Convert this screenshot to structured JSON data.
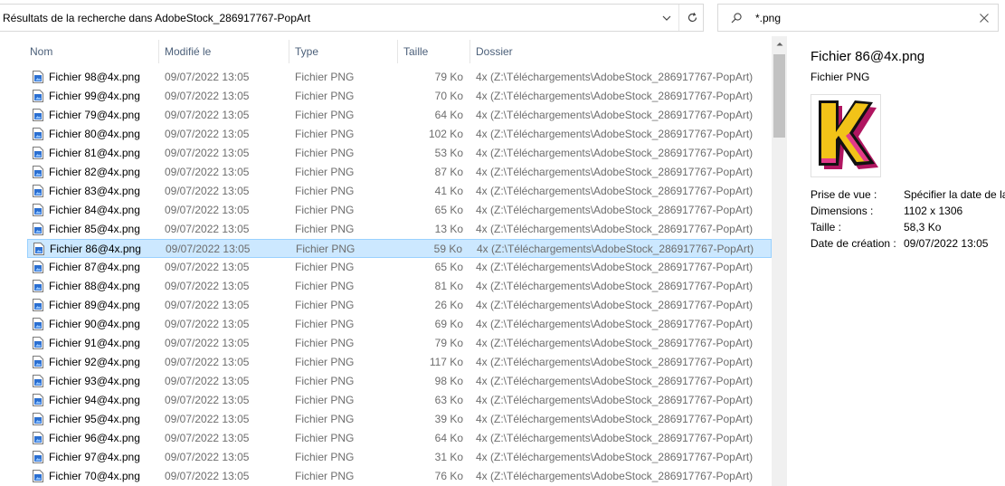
{
  "address": {
    "path": "Résultats de la recherche dans AdobeStock_286917767-PopArt"
  },
  "search": {
    "value": "*.png"
  },
  "columns": {
    "name": "Nom",
    "modified": "Modifié le",
    "type": "Type",
    "size": "Taille",
    "folder": "Dossier"
  },
  "files": [
    {
      "name": "Fichier 98@4x.png",
      "modified": "09/07/2022 13:05",
      "type": "Fichier PNG",
      "size": "79 Ko",
      "folder": "4x (Z:\\Téléchargements\\AdobeStock_286917767-PopArt)"
    },
    {
      "name": "Fichier 99@4x.png",
      "modified": "09/07/2022 13:05",
      "type": "Fichier PNG",
      "size": "70 Ko",
      "folder": "4x (Z:\\Téléchargements\\AdobeStock_286917767-PopArt)"
    },
    {
      "name": "Fichier 79@4x.png",
      "modified": "09/07/2022 13:05",
      "type": "Fichier PNG",
      "size": "64 Ko",
      "folder": "4x (Z:\\Téléchargements\\AdobeStock_286917767-PopArt)"
    },
    {
      "name": "Fichier 80@4x.png",
      "modified": "09/07/2022 13:05",
      "type": "Fichier PNG",
      "size": "102 Ko",
      "folder": "4x (Z:\\Téléchargements\\AdobeStock_286917767-PopArt)"
    },
    {
      "name": "Fichier 81@4x.png",
      "modified": "09/07/2022 13:05",
      "type": "Fichier PNG",
      "size": "53 Ko",
      "folder": "4x (Z:\\Téléchargements\\AdobeStock_286917767-PopArt)"
    },
    {
      "name": "Fichier 82@4x.png",
      "modified": "09/07/2022 13:05",
      "type": "Fichier PNG",
      "size": "87 Ko",
      "folder": "4x (Z:\\Téléchargements\\AdobeStock_286917767-PopArt)"
    },
    {
      "name": "Fichier 83@4x.png",
      "modified": "09/07/2022 13:05",
      "type": "Fichier PNG",
      "size": "41 Ko",
      "folder": "4x (Z:\\Téléchargements\\AdobeStock_286917767-PopArt)"
    },
    {
      "name": "Fichier 84@4x.png",
      "modified": "09/07/2022 13:05",
      "type": "Fichier PNG",
      "size": "65 Ko",
      "folder": "4x (Z:\\Téléchargements\\AdobeStock_286917767-PopArt)"
    },
    {
      "name": "Fichier 85@4x.png",
      "modified": "09/07/2022 13:05",
      "type": "Fichier PNG",
      "size": "13 Ko",
      "folder": "4x (Z:\\Téléchargements\\AdobeStock_286917767-PopArt)"
    },
    {
      "name": "Fichier 86@4x.png",
      "modified": "09/07/2022 13:05",
      "type": "Fichier PNG",
      "size": "59 Ko",
      "folder": "4x (Z:\\Téléchargements\\AdobeStock_286917767-PopArt)",
      "selected": true
    },
    {
      "name": "Fichier 87@4x.png",
      "modified": "09/07/2022 13:05",
      "type": "Fichier PNG",
      "size": "65 Ko",
      "folder": "4x (Z:\\Téléchargements\\AdobeStock_286917767-PopArt)"
    },
    {
      "name": "Fichier 88@4x.png",
      "modified": "09/07/2022 13:05",
      "type": "Fichier PNG",
      "size": "81 Ko",
      "folder": "4x (Z:\\Téléchargements\\AdobeStock_286917767-PopArt)"
    },
    {
      "name": "Fichier 89@4x.png",
      "modified": "09/07/2022 13:05",
      "type": "Fichier PNG",
      "size": "26 Ko",
      "folder": "4x (Z:\\Téléchargements\\AdobeStock_286917767-PopArt)"
    },
    {
      "name": "Fichier 90@4x.png",
      "modified": "09/07/2022 13:05",
      "type": "Fichier PNG",
      "size": "69 Ko",
      "folder": "4x (Z:\\Téléchargements\\AdobeStock_286917767-PopArt)"
    },
    {
      "name": "Fichier 91@4x.png",
      "modified": "09/07/2022 13:05",
      "type": "Fichier PNG",
      "size": "79 Ko",
      "folder": "4x (Z:\\Téléchargements\\AdobeStock_286917767-PopArt)"
    },
    {
      "name": "Fichier 92@4x.png",
      "modified": "09/07/2022 13:05",
      "type": "Fichier PNG",
      "size": "117 Ko",
      "folder": "4x (Z:\\Téléchargements\\AdobeStock_286917767-PopArt)"
    },
    {
      "name": "Fichier 93@4x.png",
      "modified": "09/07/2022 13:05",
      "type": "Fichier PNG",
      "size": "98 Ko",
      "folder": "4x (Z:\\Téléchargements\\AdobeStock_286917767-PopArt)"
    },
    {
      "name": "Fichier 94@4x.png",
      "modified": "09/07/2022 13:05",
      "type": "Fichier PNG",
      "size": "63 Ko",
      "folder": "4x (Z:\\Téléchargements\\AdobeStock_286917767-PopArt)"
    },
    {
      "name": "Fichier 95@4x.png",
      "modified": "09/07/2022 13:05",
      "type": "Fichier PNG",
      "size": "39 Ko",
      "folder": "4x (Z:\\Téléchargements\\AdobeStock_286917767-PopArt)"
    },
    {
      "name": "Fichier 96@4x.png",
      "modified": "09/07/2022 13:05",
      "type": "Fichier PNG",
      "size": "64 Ko",
      "folder": "4x (Z:\\Téléchargements\\AdobeStock_286917767-PopArt)"
    },
    {
      "name": "Fichier 97@4x.png",
      "modified": "09/07/2022 13:05",
      "type": "Fichier PNG",
      "size": "31 Ko",
      "folder": "4x (Z:\\Téléchargements\\AdobeStock_286917767-PopArt)"
    },
    {
      "name": "Fichier 70@4x.png",
      "modified": "09/07/2022 13:05",
      "type": "Fichier PNG",
      "size": "76 Ko",
      "folder": "4x (Z:\\Téléchargements\\AdobeStock_286917767-PopArt)"
    }
  ],
  "preview": {
    "title": "Fichier 86@4x.png",
    "type": "Fichier PNG",
    "meta": [
      {
        "label": "Prise de vue :",
        "value": "Spécifier la date de la"
      },
      {
        "label": "Dimensions :",
        "value": "1102 x 1306"
      },
      {
        "label": "Taille :",
        "value": "58,3 Ko"
      },
      {
        "label": "Date de création :",
        "value": "09/07/2022 13:05"
      }
    ]
  },
  "colors": {
    "selection_bg": "#cce8ff",
    "selection_border": "#99d1ff",
    "header_text": "#4c607a",
    "secondary_text": "#6d6d6d"
  },
  "icons": {
    "file_icon": "png-file-icon",
    "refresh": "refresh-icon",
    "search": "search-icon",
    "clear": "close-icon",
    "dropdown": "chevron-down-icon"
  }
}
